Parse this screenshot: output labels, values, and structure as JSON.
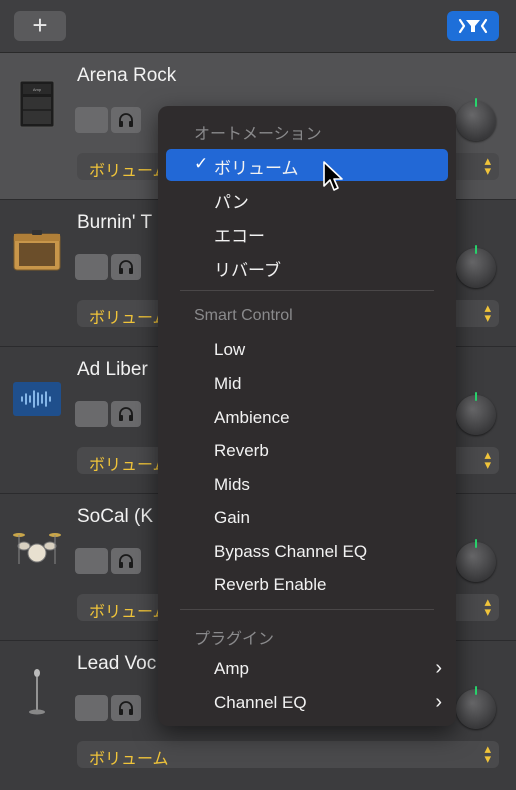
{
  "toolbar": {
    "add_label": "+",
    "add_icon": "plus-icon",
    "filter_icon": "track-filter-icon",
    "accent_color": "#1e6fd9"
  },
  "tracks": [
    {
      "name": "Arena Rock",
      "icon": "amp-stack-icon",
      "automation": "ボリューム"
    },
    {
      "name": "Burnin' T",
      "icon": "combo-amp-icon",
      "automation": "ボリューム"
    },
    {
      "name": "Ad Liber",
      "icon": "audio-waveform-icon",
      "automation": "ボリューム"
    },
    {
      "name": "SoCal (K",
      "icon": "drum-kit-icon",
      "automation": "ボリューム"
    },
    {
      "name": "Lead Voc",
      "icon": "microphone-icon",
      "automation": "ボリューム"
    }
  ],
  "menu": {
    "section_automation": "オートメーション",
    "checkmark": "✓",
    "automation_items": [
      "ボリューム",
      "パン",
      "エコー",
      "リバーブ"
    ],
    "selected_item": "ボリューム",
    "section_smart_control": "Smart Control",
    "smart_control_items": [
      "Low",
      "Mid",
      "Ambience",
      "Reverb",
      "Mids",
      "Gain",
      "Bypass Channel EQ",
      "Reverb Enable"
    ],
    "section_plugins": "プラグイン",
    "plugin_items": [
      "Amp",
      "Channel EQ"
    ],
    "submenu_arrow": "›",
    "highlight_color": "#2268d6"
  }
}
